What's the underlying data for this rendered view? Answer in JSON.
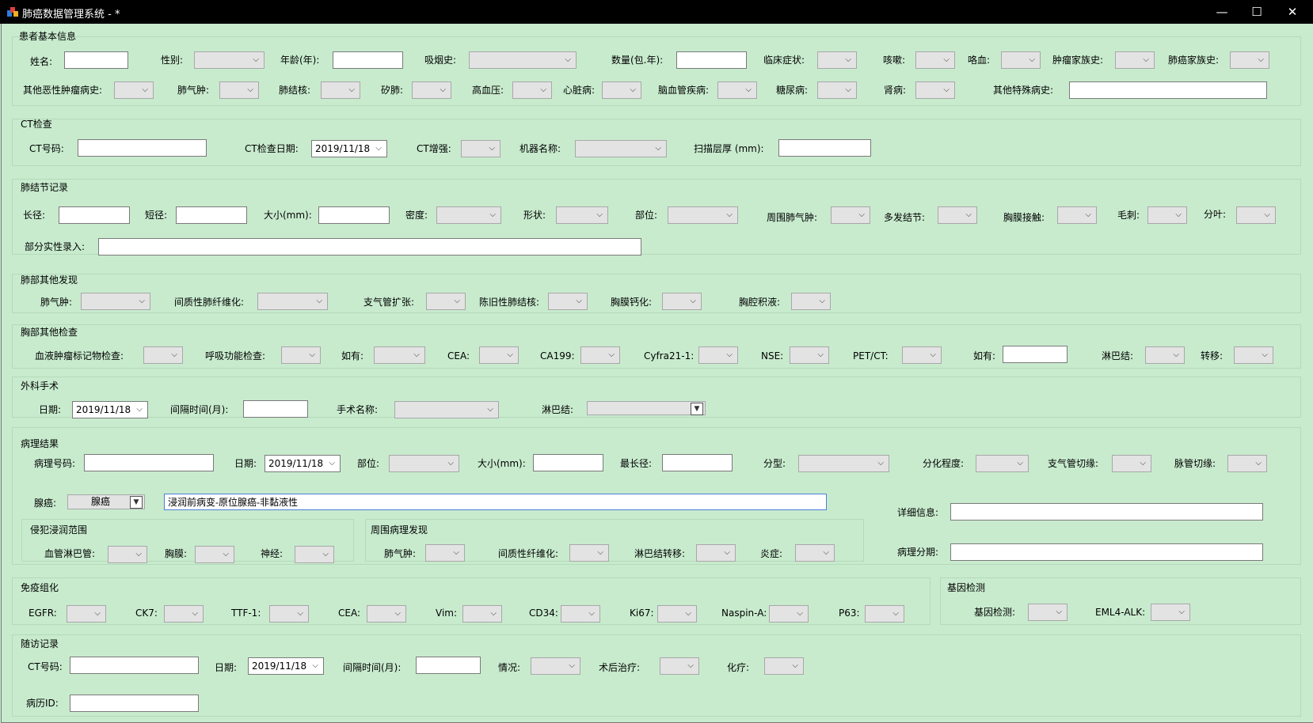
{
  "window": {
    "title": "肺癌数据管理系统 - *",
    "minimize": "—",
    "maximize": "☐",
    "close": "✕"
  },
  "sections": {
    "patient": "患者基本信息",
    "ct": "CT检查",
    "nodule": "肺结节记录",
    "lung_other": "肺部其他发现",
    "chest_other": "胸部其他检查",
    "surgery": "外科手术",
    "pathology": "病理结果",
    "invasion": "侵犯浸润范围",
    "peri_path": "周围病理发现",
    "ihc": "免疫组化",
    "gene": "基因检测",
    "followup": "随访记录"
  },
  "labels": {
    "name": "姓名:",
    "sex": "性别:",
    "age": "年龄(年):",
    "smoking": "吸烟史:",
    "amount": "数量(包.年):",
    "symptom": "临床症状:",
    "cough": "咳嗽:",
    "hemoptysis": "咯血:",
    "tumor_family": "肿瘤家族史:",
    "lung_cancer_family": "肺癌家族史:",
    "other_malignant": "其他恶性肿瘤病史:",
    "emphysema": "肺气肿:",
    "tb": "肺结核:",
    "silicosis": "矽肺:",
    "hypertension": "高血压:",
    "heart": "心脏病:",
    "cerebro": "脑血管疾病:",
    "diabetes": "糖尿病:",
    "kidney": "肾病:",
    "other_special": "其他特殊病史:",
    "ct_no": "CT号码:",
    "ct_date": "CT检查日期:",
    "ct_enhance": "CT增强:",
    "machine": "机器名称:",
    "slice": "扫描层厚 (mm):",
    "long_d": "长径:",
    "short_d": "短径:",
    "size_mm": "大小(mm):",
    "density": "密度:",
    "shape": "形状:",
    "location": "部位:",
    "peri_emphysema": "周围肺气肿:",
    "multiple": "多发结节:",
    "pleura_contact": "胸膜接触:",
    "spiculation": "毛刺:",
    "lobulation": "分叶:",
    "partial_solid": "部分实性录入:",
    "lo_emphysema": "肺气肿:",
    "ild": "间质性肺纤维化:",
    "bronchiectasis": "支气管扩张:",
    "old_tb": "陈旧性肺结核:",
    "pleural_calc": "胸膜钙化:",
    "effusion": "胸腔积液:",
    "blood_marker": "血液肿瘤标记物检查:",
    "resp_func": "呼吸功能检查:",
    "if_any": "如有:",
    "cea": "CEA:",
    "ca199": "CA199:",
    "cyfra": "Cyfra21-1:",
    "nse": "NSE:",
    "petct": "PET/CT:",
    "if_any2": "如有:",
    "lymph": "淋巴结:",
    "metastasis": "转移:",
    "s_date": "日期:",
    "interval": "间隔时间(月):",
    "op_name": "手术名称:",
    "s_lymph": "淋巴结:",
    "path_no": "病理号码:",
    "p_date": "日期:",
    "p_location": "部位:",
    "p_size": "大小(mm):",
    "max_d": "最长径:",
    "type": "分型:",
    "diff": "分化程度:",
    "bronchial_margin": "支气管切缘:",
    "vascular_margin": "脉管切缘:",
    "adeno": "腺癌:",
    "detail": "详细信息:",
    "stage": "病理分期:",
    "vessel_lymph": "血管淋巴管:",
    "pleura": "胸膜:",
    "nerve": "神经:",
    "pp_emphysema": "肺气肿:",
    "pp_ild": "间质性纤维化:",
    "ln_meta": "淋巴结转移:",
    "inflammation": "炎症:",
    "egfr": "EGFR:",
    "ck7": "CK7:",
    "ttf1": "TTF-1:",
    "i_cea": "CEA:",
    "vim": "Vim:",
    "cd34": "CD34:",
    "ki67": "Ki67:",
    "napsin": "Naspin-A:",
    "p63": "P63:",
    "gene_test": "基因检测:",
    "eml4": "EML4-ALK:",
    "f_ct": "CT号码:",
    "f_date": "日期:",
    "f_interval": "间隔时间(月):",
    "condition": "情况:",
    "post_treat": "术后治疗:",
    "chemo": "化疗:",
    "record_id": "病历ID:"
  },
  "values": {
    "ct_date": "2019/11/18",
    "surgery_date": "2019/11/18",
    "path_date": "2019/11/18",
    "followup_date": "2019/11/18",
    "adeno_type": "腺癌",
    "adeno_desc": "浸润前病变-原位腺癌-非黏液性"
  },
  "icons": {
    "dropdown": "⌵",
    "dropdown_dark": "▼"
  }
}
